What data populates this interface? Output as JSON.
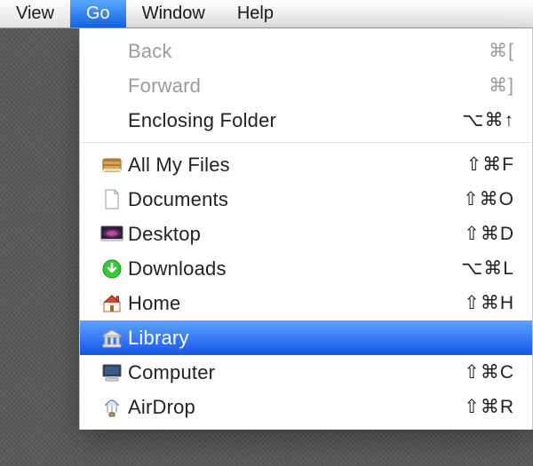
{
  "menubar": {
    "items": [
      {
        "label": "View",
        "active": false
      },
      {
        "label": "Go",
        "active": true
      },
      {
        "label": "Window",
        "active": false
      },
      {
        "label": "Help",
        "active": false
      }
    ]
  },
  "dropdown": {
    "sections": [
      [
        {
          "icon": null,
          "label": "Back",
          "shortcut": "⌘[",
          "disabled": true,
          "selected": false
        },
        {
          "icon": null,
          "label": "Forward",
          "shortcut": "⌘]",
          "disabled": true,
          "selected": false
        },
        {
          "icon": null,
          "label": "Enclosing Folder",
          "shortcut": "⌥⌘↑",
          "disabled": false,
          "selected": false
        }
      ],
      [
        {
          "icon": "all-my-files",
          "label": "All My Files",
          "shortcut": "⇧⌘F",
          "disabled": false,
          "selected": false
        },
        {
          "icon": "documents",
          "label": "Documents",
          "shortcut": "⇧⌘O",
          "disabled": false,
          "selected": false
        },
        {
          "icon": "desktop",
          "label": "Desktop",
          "shortcut": "⇧⌘D",
          "disabled": false,
          "selected": false
        },
        {
          "icon": "downloads",
          "label": "Downloads",
          "shortcut": "⌥⌘L",
          "disabled": false,
          "selected": false
        },
        {
          "icon": "home",
          "label": "Home",
          "shortcut": "⇧⌘H",
          "disabled": false,
          "selected": false
        },
        {
          "icon": "library",
          "label": "Library",
          "shortcut": "",
          "disabled": false,
          "selected": true
        },
        {
          "icon": "computer",
          "label": "Computer",
          "shortcut": "⇧⌘C",
          "disabled": false,
          "selected": false
        },
        {
          "icon": "airdrop",
          "label": "AirDrop",
          "shortcut": "⇧⌘R",
          "disabled": false,
          "selected": false
        }
      ]
    ]
  },
  "colors": {
    "highlight_top": "#5ea3ff",
    "highlight_bottom": "#1556e8",
    "disabled": "#9c9c9c"
  }
}
